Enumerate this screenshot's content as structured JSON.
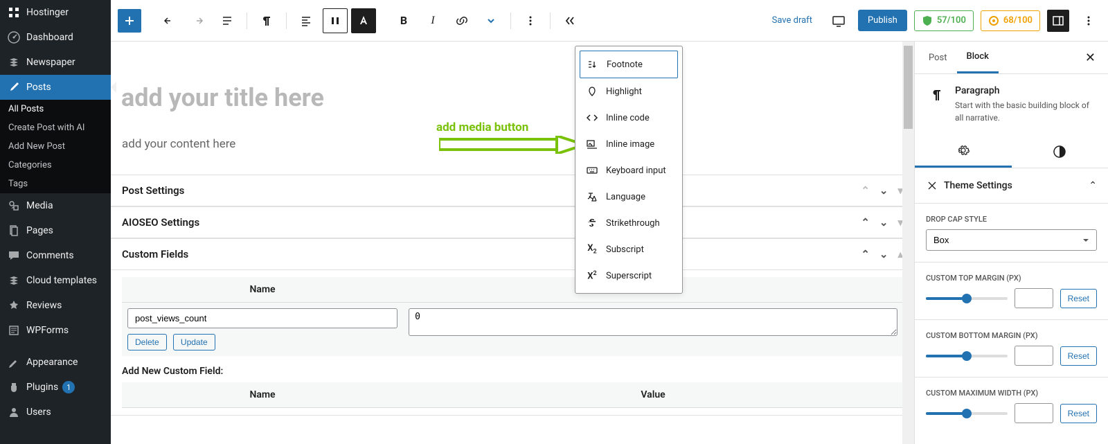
{
  "sidebar": {
    "brand": "Hostinger",
    "items": [
      {
        "label": "Dashboard"
      },
      {
        "label": "Newspaper"
      },
      {
        "label": "Posts"
      },
      {
        "label": "Media"
      },
      {
        "label": "Pages"
      },
      {
        "label": "Comments"
      },
      {
        "label": "Cloud templates"
      },
      {
        "label": "Reviews"
      },
      {
        "label": "WPForms"
      },
      {
        "label": "Appearance"
      },
      {
        "label": "Plugins"
      },
      {
        "label": "Users"
      }
    ],
    "plugins_badge": "1",
    "sub": {
      "all": "All Posts",
      "ai": "Create Post with AI",
      "add": "Add New Post",
      "cats": "Categories",
      "tags": "Tags"
    }
  },
  "toolbar": {
    "save_draft": "Save draft",
    "publish": "Publish",
    "score1": "57/100",
    "score2": "68/100"
  },
  "editor": {
    "title_placeholder": "add your title here",
    "content_placeholder": "add your content here",
    "annotation": "add media button"
  },
  "dropdown": {
    "items": [
      {
        "label": "Footnote"
      },
      {
        "label": "Highlight"
      },
      {
        "label": "Inline code"
      },
      {
        "label": "Inline image"
      },
      {
        "label": "Keyboard input"
      },
      {
        "label": "Language"
      },
      {
        "label": "Strikethrough"
      },
      {
        "label": "Subscript"
      },
      {
        "label": "Superscript"
      }
    ]
  },
  "metaboxes": {
    "post_settings": "Post Settings",
    "aioseo": "AIOSEO Settings",
    "custom_fields": "Custom Fields",
    "name_col": "Name",
    "value_col": "Value",
    "row_name": "post_views_count",
    "row_value": "0",
    "delete": "Delete",
    "update": "Update",
    "add_new": "Add New Custom Field:"
  },
  "rpanel": {
    "tab_post": "Post",
    "tab_block": "Block",
    "block_title": "Paragraph",
    "block_desc": "Start with the basic building block of all narrative.",
    "theme_settings": "Theme Settings",
    "drop_cap_label": "Drop cap style",
    "drop_cap_value": "Box",
    "top_margin": "Custom top margin (px)",
    "bottom_margin": "Custom bottom margin (px)",
    "max_width": "Custom maximum width (px)",
    "reset": "Reset"
  }
}
